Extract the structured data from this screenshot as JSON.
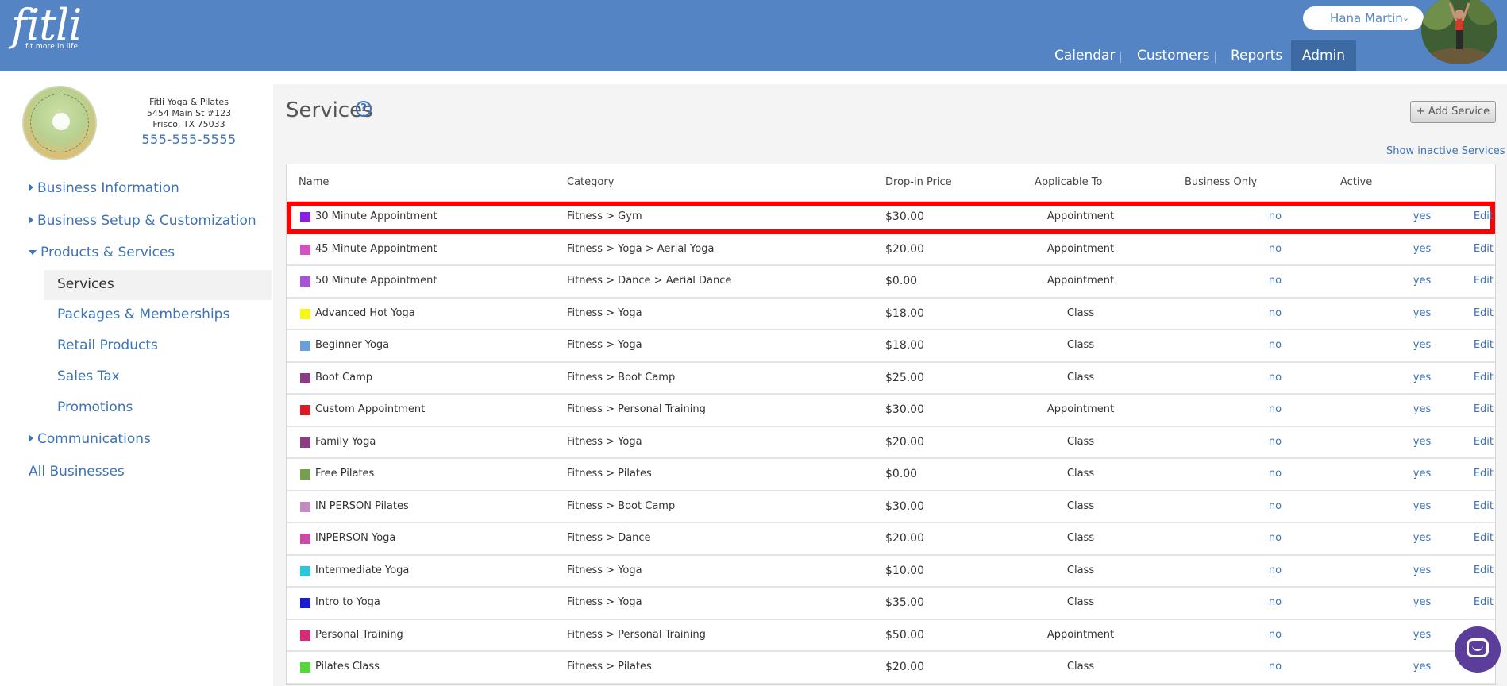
{
  "app": {
    "logo_text": "fitli",
    "logo_tagline": "fit more in life",
    "brand_color": "#5584c4"
  },
  "user": {
    "name": "Hana Martin"
  },
  "nav": {
    "calendar": "Calendar",
    "customers": "Customers",
    "reports": "Reports",
    "admin": "Admin"
  },
  "business": {
    "name": "Fitli Yoga & Pilates",
    "address1": "5454 Main St #123",
    "address2": "Frisco, TX 75033",
    "phone": "555-555-5555"
  },
  "sidebar": {
    "business_information": "Business Information",
    "business_setup": "Business Setup & Customization",
    "products_services": "Products & Services",
    "services": "Services",
    "packages": "Packages & Memberships",
    "retail": "Retail Products",
    "sales_tax": "Sales Tax",
    "promotions": "Promotions",
    "communications": "Communications",
    "all_businesses": "All Businesses"
  },
  "page": {
    "title": "Services",
    "help": "?",
    "add_button": "+ Add Service",
    "show_inactive": "Show inactive Services"
  },
  "table": {
    "headers": {
      "name": "Name",
      "category": "Category",
      "price": "Drop-in Price",
      "applicable": "Applicable To",
      "business_only": "Business Only",
      "active": "Active"
    },
    "rows": [
      {
        "color": "#8a1de6",
        "name": "30 Minute Appointment",
        "category": "Fitness > Gym",
        "price": "$30.00",
        "applicable": "Appointment",
        "business_only": "no",
        "active": "yes",
        "edit": "Edit"
      },
      {
        "color": "#d64fc4",
        "name": "45 Minute Appointment",
        "category": "Fitness > Yoga > Aerial Yoga",
        "price": "$20.00",
        "applicable": "Appointment",
        "business_only": "no",
        "active": "yes",
        "edit": "Edit"
      },
      {
        "color": "#a852d8",
        "name": "50 Minute Appointment",
        "category": "Fitness > Dance > Aerial Dance",
        "price": "$0.00",
        "applicable": "Appointment",
        "business_only": "no",
        "active": "yes",
        "edit": "Edit"
      },
      {
        "color": "#f7f51a",
        "name": "Advanced Hot Yoga",
        "category": "Fitness > Yoga",
        "price": "$18.00",
        "applicable": "Class",
        "business_only": "no",
        "active": "yes",
        "edit": "Edit"
      },
      {
        "color": "#6a9ed8",
        "name": "Beginner Yoga",
        "category": "Fitness > Yoga",
        "price": "$18.00",
        "applicable": "Class",
        "business_only": "no",
        "active": "yes",
        "edit": "Edit"
      },
      {
        "color": "#8a3c86",
        "name": "Boot Camp",
        "category": "Fitness > Boot Camp",
        "price": "$25.00",
        "applicable": "Class",
        "business_only": "no",
        "active": "yes",
        "edit": "Edit"
      },
      {
        "color": "#d91c24",
        "name": "Custom Appointment",
        "category": "Fitness > Personal Training",
        "price": "$30.00",
        "applicable": "Appointment",
        "business_only": "no",
        "active": "yes",
        "edit": "Edit"
      },
      {
        "color": "#8e3a84",
        "name": "Family Yoga",
        "category": "Fitness > Yoga",
        "price": "$20.00",
        "applicable": "Class",
        "business_only": "no",
        "active": "yes",
        "edit": "Edit"
      },
      {
        "color": "#74a04a",
        "name": "Free Pilates",
        "category": "Fitness > Pilates",
        "price": "$0.00",
        "applicable": "Class",
        "business_only": "no",
        "active": "yes",
        "edit": "Edit"
      },
      {
        "color": "#c48ac2",
        "name": "IN PERSON Pilates",
        "category": "Fitness > Boot Camp",
        "price": "$30.00",
        "applicable": "Class",
        "business_only": "no",
        "active": "yes",
        "edit": "Edit"
      },
      {
        "color": "#c94aa8",
        "name": "INPERSON Yoga",
        "category": "Fitness > Dance",
        "price": "$20.00",
        "applicable": "Class",
        "business_only": "no",
        "active": "yes",
        "edit": "Edit"
      },
      {
        "color": "#2bc8d8",
        "name": "Intermediate Yoga",
        "category": "Fitness > Yoga",
        "price": "$10.00",
        "applicable": "Class",
        "business_only": "no",
        "active": "yes",
        "edit": "Edit"
      },
      {
        "color": "#1a1ad0",
        "name": "Intro to Yoga",
        "category": "Fitness > Yoga",
        "price": "$35.00",
        "applicable": "Class",
        "business_only": "no",
        "active": "yes",
        "edit": "Edit"
      },
      {
        "color": "#d82878",
        "name": "Personal Training",
        "category": "Fitness > Personal Training",
        "price": "$50.00",
        "applicable": "Appointment",
        "business_only": "no",
        "active": "yes",
        "edit": ""
      },
      {
        "color": "#52d838",
        "name": "Pilates Class",
        "category": "Fitness > Pilates",
        "price": "$20.00",
        "applicable": "Class",
        "business_only": "no",
        "active": "yes",
        "edit": ""
      }
    ]
  },
  "highlight_color": "#ff0000"
}
